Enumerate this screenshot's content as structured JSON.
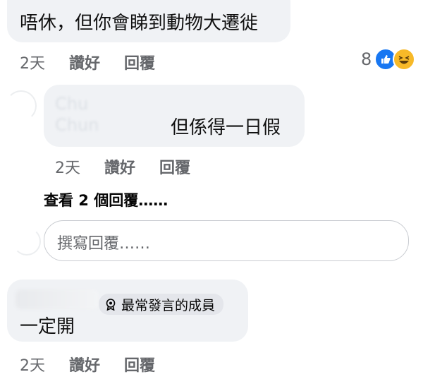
{
  "comment1": {
    "text": "唔休，但你會睇到動物大遷徙",
    "time": "2天",
    "like_label": "讚好",
    "reply_label": "回覆",
    "reaction_count": "8"
  },
  "reply1": {
    "author_line1": "Chu",
    "author_line2": "Chun",
    "text": "但係得一日假",
    "time": "2天",
    "like_label": "讚好",
    "reply_label": "回覆"
  },
  "view_replies": {
    "label": "查看 2 個回覆……"
  },
  "reply_box": {
    "placeholder": "撰寫回覆……"
  },
  "comment2": {
    "badge": "最常發言的成員",
    "text": "一定開",
    "time": "2天",
    "like_label": "讚好",
    "reply_label": "回覆"
  },
  "colors": {
    "like_blue": "#1877f2",
    "haha_yellow": "#f7b928",
    "bubble_bg": "#f0f2f5",
    "meta_gray": "#65676b"
  },
  "icons": [
    "like-reaction-icon",
    "haha-reaction-icon",
    "top-contributor-badge-icon"
  ]
}
